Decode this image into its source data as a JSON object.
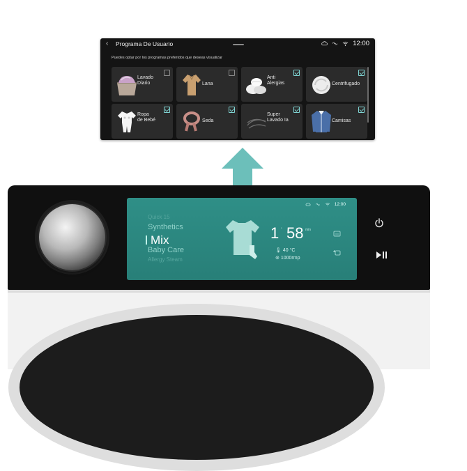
{
  "upper_screen": {
    "back_icon": "chevron-left-icon",
    "title": "Programa De Usuario",
    "status_icons": [
      "cloud-icon",
      "link-icon",
      "wifi-icon"
    ],
    "time": "12:00",
    "subtitle": "Puedes optar por los programas preferidos que deseas visualizar",
    "programs": [
      {
        "label": "Lavado Diario",
        "lines": [
          "Lavado",
          "Diario"
        ],
        "checked": false,
        "icon": "towels-basket-icon"
      },
      {
        "label": "Lana",
        "lines": [
          "Lana"
        ],
        "checked": false,
        "icon": "wool-sweater-icon"
      },
      {
        "label": "Anti Alergias",
        "lines": [
          "Anti",
          "Alergias"
        ],
        "checked": true,
        "icon": "towels-icon"
      },
      {
        "label": "Centrifugado",
        "lines": [
          "Centrifugado"
        ],
        "checked": true,
        "icon": "spin-clothes-icon"
      },
      {
        "label": "Ropa de Bebé",
        "lines": [
          "Ropa",
          "de Bebé"
        ],
        "checked": true,
        "icon": "baby-clothes-icon"
      },
      {
        "label": "Seda",
        "lines": [
          "Seda"
        ],
        "checked": true,
        "icon": "silk-scarf-icon"
      },
      {
        "label": "Super Lavado Ia",
        "lines": [
          "Super",
          "Lavado Ia"
        ],
        "checked": true,
        "icon": "swirl-icon"
      },
      {
        "label": "Camisas",
        "lines": [
          "Camisas"
        ],
        "checked": true,
        "icon": "shirt-icon"
      }
    ]
  },
  "machine_display": {
    "status_icons": [
      "cloud-icon",
      "link-icon",
      "wifi-icon"
    ],
    "time": "12:00",
    "programs": [
      "Quick 15",
      "Synthetics",
      "Mix",
      "Baby Care",
      "Allergy Steam"
    ],
    "selected_program": "Mix",
    "timer_hours": "1",
    "timer_minutes": "58",
    "timer_unit": "min",
    "temperature": "40 °C",
    "spin": "1000rmp"
  },
  "buttons": {
    "power_icon": "power-icon",
    "start_pause_icon": "play-pause-icon"
  },
  "colors": {
    "lcd": "#2f8f87",
    "accent": "#7fd4d3",
    "arrow": "#5cb8b2",
    "panel_bg": "#141414",
    "tile_bg": "#2b2b2b"
  }
}
